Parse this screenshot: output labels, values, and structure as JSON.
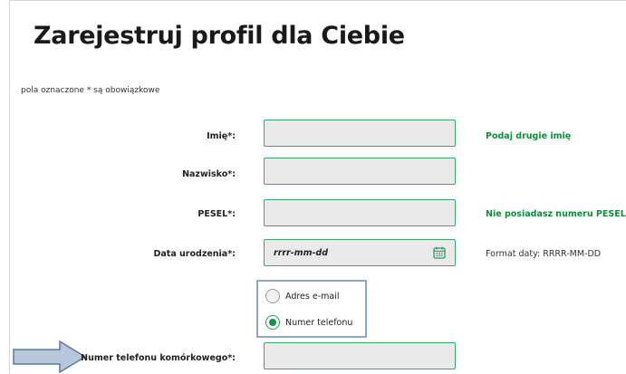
{
  "title": "Zarejestruj profil dla Ciebie",
  "required_note": "pola oznaczone * są obowiązkowe",
  "fields": {
    "first_name": {
      "label": "Imię*:",
      "value": ""
    },
    "last_name": {
      "label": "Nazwisko*:",
      "value": ""
    },
    "pesel": {
      "label": "PESEL*:",
      "value": ""
    },
    "birth_date": {
      "label": "Data urodzenia*:",
      "value": "rrrr-mm-dd",
      "icon": "calendar-icon"
    },
    "mobile_phone": {
      "label": "Numer telefonu komórkowego*:",
      "value": ""
    }
  },
  "side": {
    "second_name_link": "Podaj drugie imię",
    "no_pesel_link": "Nie posiadasz numeru PESEL?",
    "date_format_note": "Format daty: RRRR-MM-DD"
  },
  "contact_method": {
    "options": [
      {
        "label": "Adres e-mail",
        "selected": false
      },
      {
        "label": "Numer telefonu",
        "selected": true
      }
    ]
  },
  "colors": {
    "accent_green": "#138a3c",
    "field_border": "#3aa86b",
    "field_bg": "#eaeaea",
    "radio_group_border": "#8fa6c6",
    "arrow_fill": "#b8c7dc",
    "arrow_stroke": "#5d79a3"
  }
}
